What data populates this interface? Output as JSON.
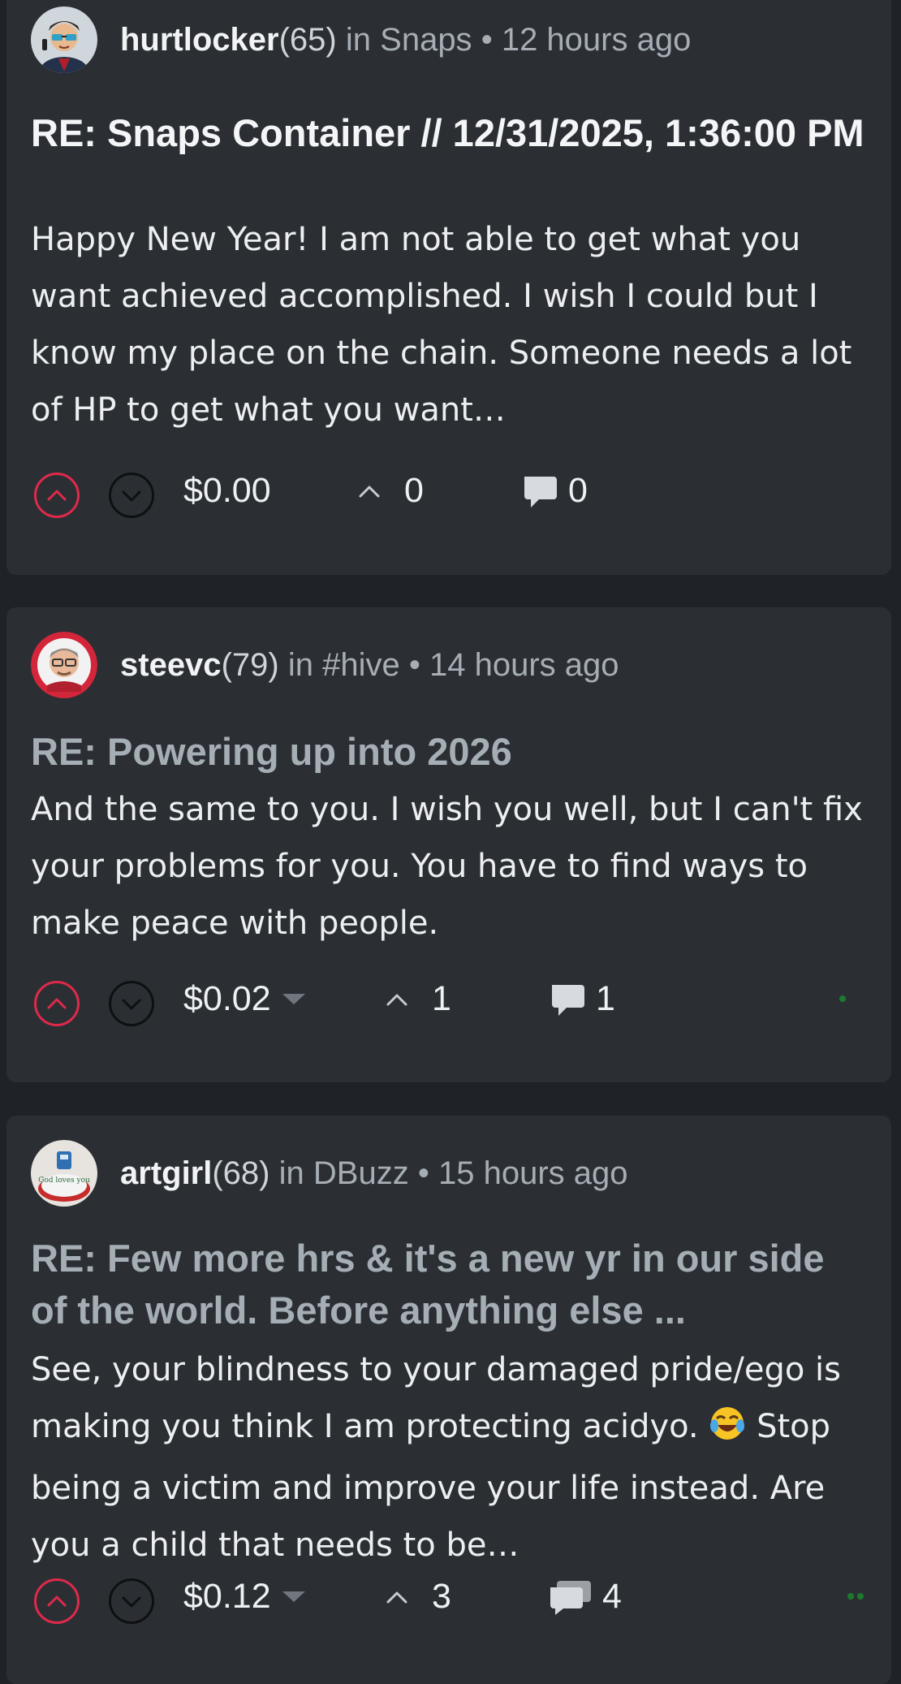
{
  "posts": [
    {
      "author": "hurtlocker",
      "reputation": "(65)",
      "community_prefix": "in",
      "community": "Snaps",
      "separator": "•",
      "time_ago": "12 hours ago",
      "title": "RE: Snaps Container // 12/31/2025, 1:36:00 PM",
      "body": "Happy New Year! I am not able to get what you want achieved accomplished. I wish I could but I know my place on the chain. Someone needs a lot of HP to get what you want…",
      "payout": "$0.00",
      "votes": "0",
      "comments": "0",
      "avatar_icon": "avatar-cartoon-sunglasses"
    },
    {
      "author": "steevc",
      "reputation": "(79)",
      "community_prefix": "in",
      "community": "#hive",
      "separator": "•",
      "time_ago": "14 hours ago",
      "title": "RE: Powering up into 2026",
      "body": "And the same to you. I wish you well, but I can't fix your problems for you. You have to find ways to make peace with people.",
      "payout": "$0.02",
      "votes": "1",
      "comments": "1",
      "avatar_icon": "avatar-cartoon-glasses"
    },
    {
      "author": "artgirl",
      "reputation": "(68)",
      "community_prefix": "in",
      "community": "DBuzz",
      "separator": "•",
      "time_ago": "15 hours ago",
      "title": "RE: Few more hrs & it's a new yr in our side of the world. Before anything else ...",
      "body_part1": "See, your blindness to your damaged pride/ego is making you think I am protecting acidyo.",
      "body_emoji": "face-with-tears-of-joy-emoji",
      "body_part2": "Stop being a victim and improve your life instead. Are you a child that needs to be…",
      "payout": "$0.12",
      "votes": "3",
      "comments": "4",
      "avatar_icon": "avatar-god-loves-you"
    }
  ],
  "colors": {
    "background": "#1f2226",
    "card": "#2b2f34",
    "upvote": "#e0294a",
    "muted_text": "#a6adb4",
    "online_dot": "#1b7a2d"
  }
}
